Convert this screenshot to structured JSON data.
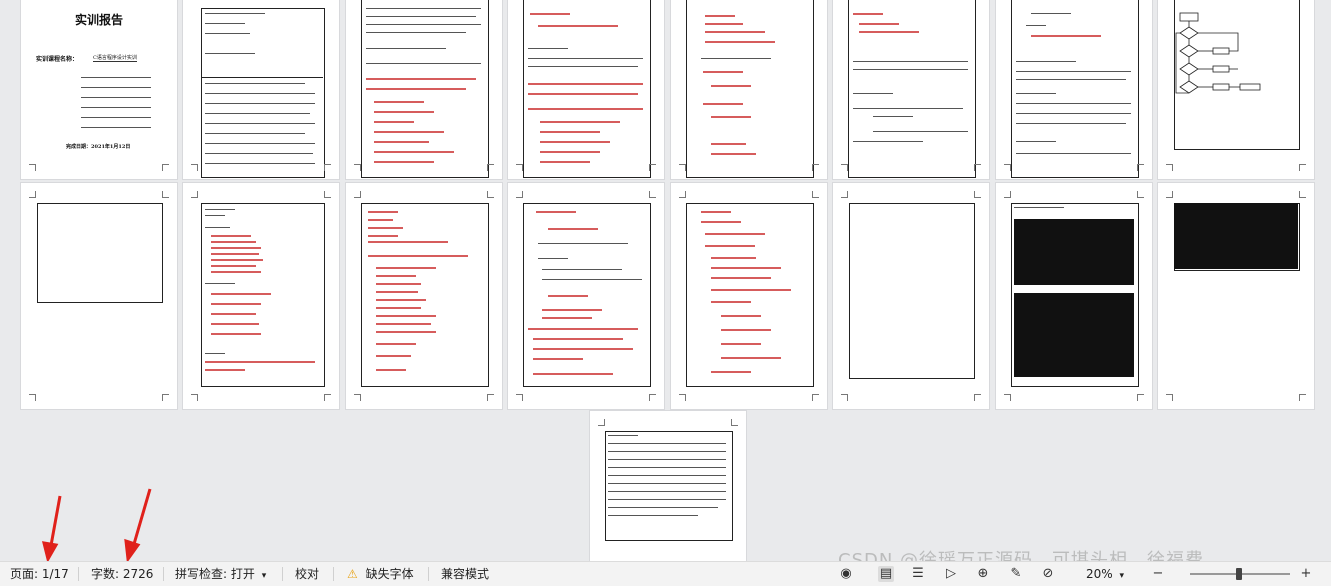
{
  "document": {
    "cover_title": "实训报告",
    "cover_subtitle": "实训课程名称：",
    "cover_course": "C语言程序设计实训",
    "cover_date": "完成日期：2021年1月12日"
  },
  "statusbar": {
    "page": "页面: 1/17",
    "wordcount": "字数: 2726",
    "spellcheck": "拼写检查: 打开",
    "proofread": "校对",
    "missing_font": "缺失字体",
    "compat_mode": "兼容模式",
    "zoom": "20%"
  },
  "watermark": "CSDN @徐瑶万正源码，可堪头相，徐福费",
  "icons": {
    "eye": "eye-icon",
    "page_view": "page-view-icon",
    "outline": "outline-view-icon",
    "play": "play-icon",
    "web": "web-view-icon",
    "pen": "pen-icon",
    "zoom_out": "minus-icon",
    "zoom_in": "plus-icon",
    "warning": "warning-icon"
  },
  "colors": {
    "arrow": "#e0211b",
    "spellcheck_underline": "#cc3333"
  }
}
